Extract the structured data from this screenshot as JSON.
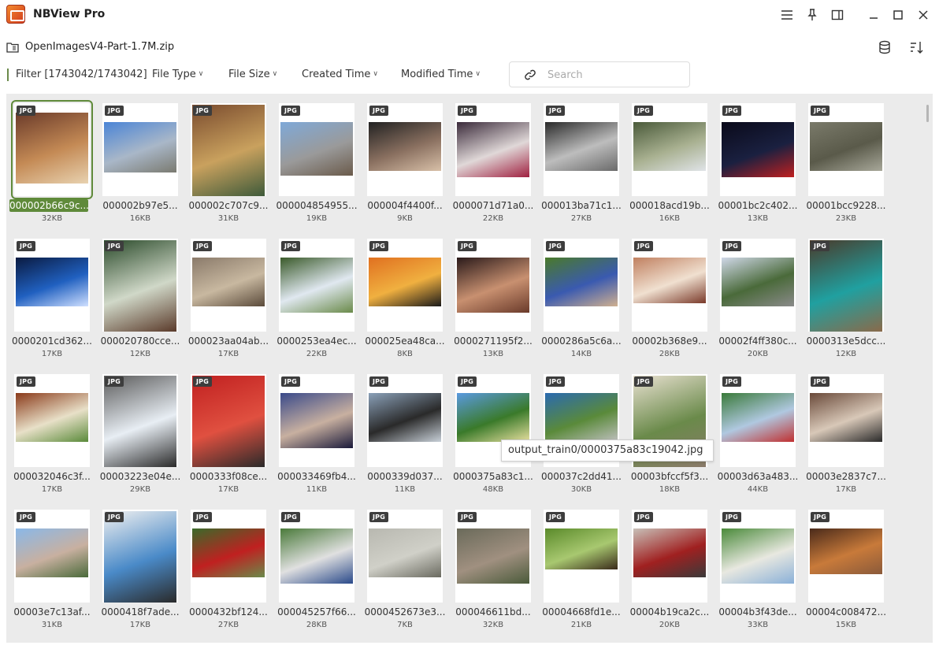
{
  "app": {
    "title": "NBView Pro"
  },
  "path": {
    "text": "OpenImagesV4-Part-1.7M.zip"
  },
  "filter": {
    "label": "Filter [1743042/1743042]",
    "dropdowns": [
      "File Type",
      "File Size",
      "Created Time",
      "Modified Time"
    ],
    "search_placeholder": "Search"
  },
  "tooltip": {
    "text": "output_train0/0000375a83c19042.jpg"
  },
  "badge": "JPG",
  "files": [
    {
      "name": "000002b66c9c...",
      "size": "32KB",
      "colors": [
        "#6b3b2a",
        "#c48a55",
        "#e8d2b0"
      ]
    },
    {
      "name": "000002b97e5...",
      "size": "16KB",
      "colors": [
        "#4a84d6",
        "#a9b7c8",
        "#7a7a70"
      ]
    },
    {
      "name": "000002c707c9...",
      "size": "31KB",
      "colors": [
        "#7a4b2e",
        "#c9a15e",
        "#3e5a3a"
      ]
    },
    {
      "name": "000004854955...",
      "size": "19KB",
      "colors": [
        "#7fa9d8",
        "#9a9a9a",
        "#6a5a4a"
      ]
    },
    {
      "name": "000004f4400f...",
      "size": "9KB",
      "colors": [
        "#222222",
        "#8a7060",
        "#d8c0a8"
      ]
    },
    {
      "name": "0000071d71a0...",
      "size": "22KB",
      "colors": [
        "#3a2a3a",
        "#e0d8d8",
        "#a02040"
      ]
    },
    {
      "name": "000013ba71c1...",
      "size": "27KB",
      "colors": [
        "#2a2a2a",
        "#bdbdbd",
        "#6a6a6a"
      ]
    },
    {
      "name": "000018acd19b...",
      "size": "16KB",
      "colors": [
        "#4a5a3a",
        "#a8b090",
        "#e0e4e8"
      ]
    },
    {
      "name": "00001bc2c402...",
      "size": "13KB",
      "colors": [
        "#0a0a1a",
        "#1a2040",
        "#c02020"
      ]
    },
    {
      "name": "00001bcc9228...",
      "size": "23KB",
      "colors": [
        "#7a7a6a",
        "#5a5a4a",
        "#a8a89a"
      ]
    },
    {
      "name": "0000201cd362...",
      "size": "17KB",
      "colors": [
        "#0a1a40",
        "#2060c0",
        "#d0e0ff"
      ]
    },
    {
      "name": "000020780cce...",
      "size": "12KB",
      "colors": [
        "#2a4a2a",
        "#d0d8c8",
        "#5a3a2a"
      ]
    },
    {
      "name": "000023aa04ab...",
      "size": "17KB",
      "colors": [
        "#8a7a6a",
        "#c8b8a0",
        "#5a4a3a"
      ]
    },
    {
      "name": "0000253ea4ec...",
      "size": "22KB",
      "colors": [
        "#3a5a2a",
        "#e0e8f0",
        "#6a8a4a"
      ]
    },
    {
      "name": "000025ea48ca...",
      "size": "8KB",
      "colors": [
        "#e07020",
        "#f0b040",
        "#1a1a1a"
      ]
    },
    {
      "name": "0000271195f2...",
      "size": "13KB",
      "colors": [
        "#2a1a1a",
        "#c89070",
        "#6a3a2a"
      ]
    },
    {
      "name": "0000286a5c6a...",
      "size": "14KB",
      "colors": [
        "#4a7a2a",
        "#3a5ab0",
        "#d0b090"
      ]
    },
    {
      "name": "00002b368e9...",
      "size": "28KB",
      "colors": [
        "#c08060",
        "#f0e0d0",
        "#7a3a2a"
      ]
    },
    {
      "name": "00002f4ff380c...",
      "size": "20KB",
      "colors": [
        "#d0d8e8",
        "#4a6a3a",
        "#8a8a8a"
      ]
    },
    {
      "name": "0000313e5dcc...",
      "size": "12KB",
      "colors": [
        "#4a3a2a",
        "#20a0a0",
        "#8a6a4a"
      ]
    },
    {
      "name": "000032046c3f...",
      "size": "17KB",
      "colors": [
        "#8a3a1a",
        "#e8e0c8",
        "#5a8a3a"
      ]
    },
    {
      "name": "00003223e04e...",
      "size": "29KB",
      "colors": [
        "#5a5a5a",
        "#e8eef4",
        "#2a2a2a"
      ]
    },
    {
      "name": "0000333f08ce...",
      "size": "17KB",
      "colors": [
        "#c02020",
        "#e05040",
        "#2a2a2a"
      ]
    },
    {
      "name": "000033469fb4...",
      "size": "11KB",
      "colors": [
        "#3a4a8a",
        "#c8b0a0",
        "#1a1a3a"
      ]
    },
    {
      "name": "0000339d037...",
      "size": "11KB",
      "colors": [
        "#8aa0b8",
        "#2a2a2a",
        "#c8d0d8"
      ]
    },
    {
      "name": "0000375a83c1...",
      "size": "48KB",
      "colors": [
        "#5a9ae0",
        "#3a7a2a",
        "#e8e0a0"
      ]
    },
    {
      "name": "000037c2dd41...",
      "size": "30KB",
      "colors": [
        "#2a6ab0",
        "#5a8a3a",
        "#c0c0c0"
      ]
    },
    {
      "name": "00003bfccf5f3...",
      "size": "18KB",
      "colors": [
        "#e8e0d0",
        "#6a8a4a",
        "#8a7a6a"
      ]
    },
    {
      "name": "00003d63a483...",
      "size": "44KB",
      "colors": [
        "#3a7a3a",
        "#b0c8e0",
        "#c03030"
      ]
    },
    {
      "name": "00003e2837c7...",
      "size": "17KB",
      "colors": [
        "#6a4a3a",
        "#d8c8b8",
        "#2a2a2a"
      ]
    },
    {
      "name": "00003e7c13af...",
      "size": "31KB",
      "colors": [
        "#8ab8e8",
        "#c8b0a0",
        "#4a6a3a"
      ]
    },
    {
      "name": "0000418f7ade...",
      "size": "17KB",
      "colors": [
        "#f0f0f0",
        "#4a8ac8",
        "#2a2a2a"
      ]
    },
    {
      "name": "0000432bf124...",
      "size": "27KB",
      "colors": [
        "#3a6a2a",
        "#c02020",
        "#6a8a4a"
      ]
    },
    {
      "name": "000045257f66...",
      "size": "28KB",
      "colors": [
        "#4a7a3a",
        "#e0e0e0",
        "#2a4a8a"
      ]
    },
    {
      "name": "0000452673e3...",
      "size": "7KB",
      "colors": [
        "#b8b8b0",
        "#d0d0c8",
        "#6a6a60"
      ]
    },
    {
      "name": "000046611bd...",
      "size": "32KB",
      "colors": [
        "#6a6a5a",
        "#a09080",
        "#4a5a3a"
      ]
    },
    {
      "name": "00004668fd1e...",
      "size": "21KB",
      "colors": [
        "#5a8a2a",
        "#a8c870",
        "#3a2a1a"
      ]
    },
    {
      "name": "00004b19ca2c...",
      "size": "20KB",
      "colors": [
        "#c8c0b8",
        "#a02020",
        "#3a3a3a"
      ]
    },
    {
      "name": "00004b3f43de...",
      "size": "33KB",
      "colors": [
        "#4a8a3a",
        "#e8e8e0",
        "#8ab0d8"
      ]
    },
    {
      "name": "00004c008472...",
      "size": "15KB",
      "colors": [
        "#4a2a1a",
        "#c87a3a",
        "#8a5a3a"
      ]
    }
  ]
}
